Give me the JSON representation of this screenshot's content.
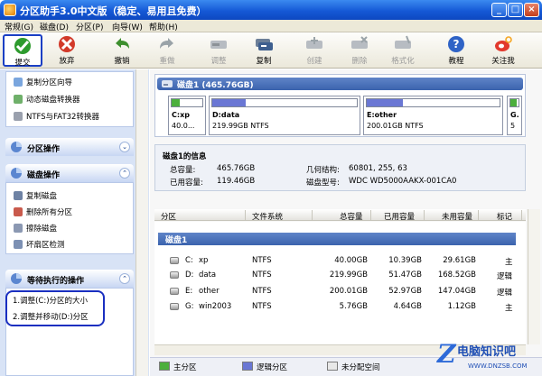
{
  "window": {
    "title": "分区助手3.0中文版（稳定、易用且免费）"
  },
  "menu": [
    "常规(G)",
    "磁盘(D)",
    "分区(P)",
    "向导(W)",
    "帮助(H)"
  ],
  "toolbar": {
    "submit": "提交",
    "discard": "放弃",
    "undo": "撤销",
    "redo": "重做",
    "adjust": "调整",
    "copy": "复制",
    "create": "创建",
    "delete": "删除",
    "format": "格式化",
    "tutorial": "教程",
    "follow": "关注我"
  },
  "sidebar": {
    "wizard_items": [
      "复制分区向导",
      "动态磁盘转换器",
      "NTFS与FAT32转换器"
    ],
    "partition_ops_title": "分区操作",
    "disk_ops_title": "磁盘操作",
    "disk_ops": [
      "复制磁盘",
      "删除所有分区",
      "擦除磁盘",
      "坏扇区检测"
    ],
    "pending_title": "等待执行的操作",
    "pending": [
      "1.调整(C:)分区的大小",
      "2.调整并移动(D:)分区"
    ]
  },
  "diskmap": {
    "header": "磁盘1 (465.76GB)",
    "partitions": [
      {
        "name": "C:xp",
        "size": "40.0...",
        "used_fraction": 0.26,
        "type": "primary"
      },
      {
        "name": "D:data",
        "size": "219.99GB NTFS",
        "used_fraction": 0.23,
        "type": "logical"
      },
      {
        "name": "E:other",
        "size": "200.01GB NTFS",
        "used_fraction": 0.27,
        "type": "logical"
      },
      {
        "name": "G.",
        "size": "5",
        "used_fraction": 0.8,
        "type": "primary"
      }
    ]
  },
  "diskinfo": {
    "title": "磁盘1的信息",
    "total_label": "总容量:",
    "total_value": "465.76GB",
    "used_label": "已用容量:",
    "used_value": "119.46GB",
    "geometry_label": "几何结构:",
    "geometry_value": "60801, 255, 63",
    "model_label": "磁盘型号:",
    "model_value": "WDC WD5000AAKX-001CA0"
  },
  "table": {
    "headers": [
      "分区",
      "文件系统",
      "总容量",
      "已用容量",
      "未用容量",
      "标记"
    ],
    "group": "磁盘1",
    "rows": [
      {
        "drive": "C:",
        "label": "xp",
        "fs": "NTFS",
        "total": "40.00GB",
        "used": "10.39GB",
        "free": "29.61GB",
        "flag": "主"
      },
      {
        "drive": "D:",
        "label": "data",
        "fs": "NTFS",
        "total": "219.99GB",
        "used": "51.47GB",
        "free": "168.52GB",
        "flag": "逻辑"
      },
      {
        "drive": "E:",
        "label": "other",
        "fs": "NTFS",
        "total": "200.01GB",
        "used": "52.97GB",
        "free": "147.04GB",
        "flag": "逻辑"
      },
      {
        "drive": "G:",
        "label": "win2003",
        "fs": "NTFS",
        "total": "5.76GB",
        "used": "4.64GB",
        "free": "1.12GB",
        "flag": "主"
      }
    ]
  },
  "legend": {
    "primary": "主分区",
    "logical": "逻辑分区",
    "unallocated": "未分配空间"
  },
  "watermark": {
    "text": "电脑知识吧",
    "url": "WWW.DNZSB.COM"
  },
  "colors": {
    "primary": "#4caf3d",
    "logical": "#6a77d4",
    "unallocated": "#e8e8e8",
    "accent": "#1559d6"
  }
}
